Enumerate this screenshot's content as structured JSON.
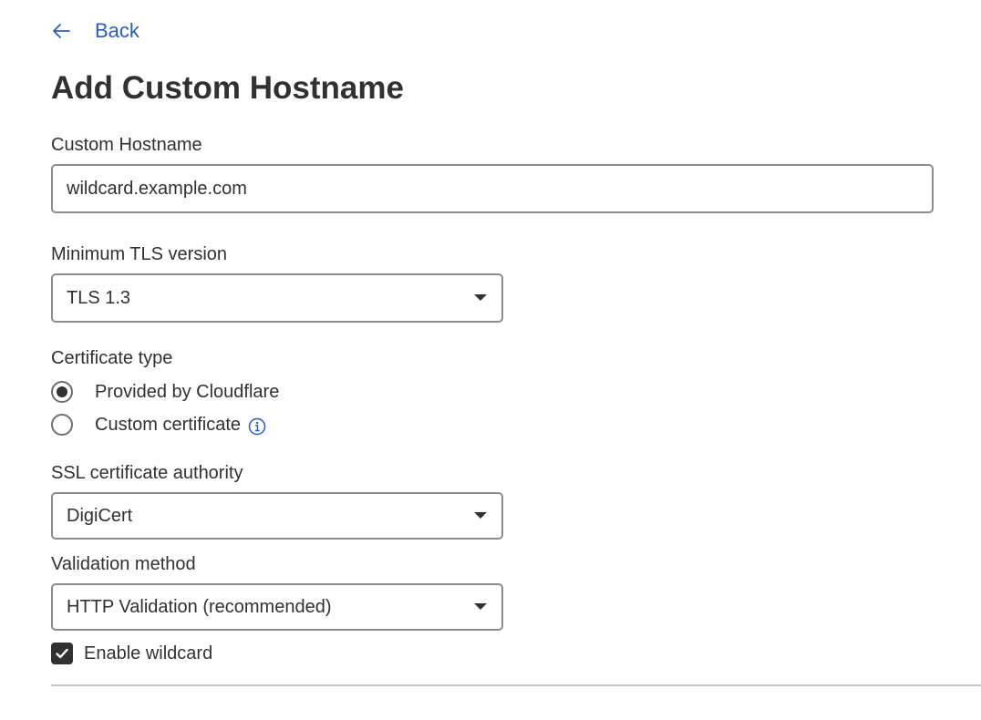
{
  "nav": {
    "back_label": "Back"
  },
  "page": {
    "title": "Add Custom Hostname"
  },
  "hostname": {
    "label": "Custom Hostname",
    "value": "wildcard.example.com"
  },
  "tls": {
    "label": "Minimum TLS version",
    "selected": "TLS 1.3"
  },
  "certificate_type": {
    "label": "Certificate type",
    "options": [
      {
        "label": "Provided by Cloudflare",
        "selected": true
      },
      {
        "label": "Custom certificate",
        "selected": false,
        "icon": "info-icon"
      }
    ]
  },
  "ssl_authority": {
    "label": "SSL certificate authority",
    "selected": "DigiCert"
  },
  "validation": {
    "label": "Validation method",
    "selected": "HTTP Validation (recommended)"
  },
  "wildcard": {
    "label": "Enable wildcard",
    "checked": true
  },
  "colors": {
    "link": "#2c5db8",
    "text": "#313131",
    "border": "#8c8c8c",
    "divider": "#c4c4c4"
  }
}
